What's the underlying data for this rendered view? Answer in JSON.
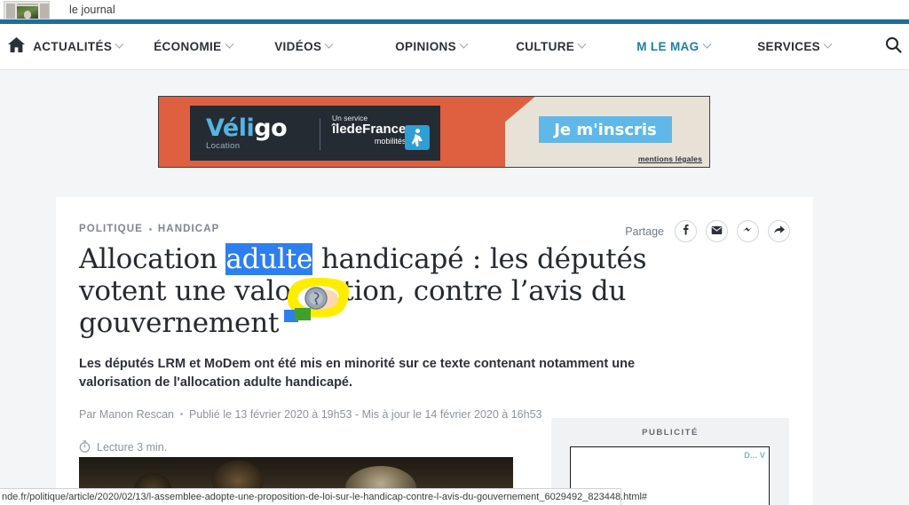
{
  "browser": {
    "tab_title": "le journal",
    "status_url": "nde.fr/politique/article/2020/02/13/l-assemblee-adopte-une-proposition-de-loi-sur-le-handicap-contre-l-avis-du-gouvernement_6029492_823448.html#"
  },
  "nav": {
    "home_icon": "home-icon",
    "search_icon": "search-icon",
    "items": [
      {
        "label": "ACTUALITÉS",
        "has_caret": true,
        "accent": false
      },
      {
        "label": "ÉCONOMIE",
        "has_caret": true,
        "accent": false
      },
      {
        "label": "VIDÉOS",
        "has_caret": true,
        "accent": false
      },
      {
        "label": "OPINIONS",
        "has_caret": true,
        "accent": false
      },
      {
        "label": "CULTURE",
        "has_caret": true,
        "accent": false
      },
      {
        "label": "M LE MAG",
        "has_caret": true,
        "accent": true
      },
      {
        "label": "SERVICES",
        "has_caret": true,
        "accent": false
      }
    ],
    "accent_color": "#1a7fa8",
    "top_rule_color": "#1a6f9e"
  },
  "ad_banner": {
    "brand": "Véligo",
    "brand_part_1": "Véli",
    "brand_part_2": "go",
    "brand_sub": "Location",
    "service_line": "Un service",
    "operator": "îledeFrance",
    "operator_light": "de",
    "operator_sub": "mobilités",
    "cta_label": "Je m'inscris",
    "legal_label": "mentions légales",
    "bg_color": "#df6040",
    "cta_color": "#5fb8e8"
  },
  "article": {
    "kicker_primary": "POLITIQUE",
    "kicker_secondary": "HANDICAP",
    "headline_part_1": "Allocation ",
    "headline_selected": "adulte",
    "headline_part_2": " handicapé : les députés votent une valorisation, contre l’avis du gouvernement",
    "selection_color": "#2d7fef",
    "standfirst": "Les députés LRM et MoDem ont été mis en minorité sur ce texte contenant notamment une valorisation de l'allocation adulte handicapé.",
    "author": "Par Manon Rescan",
    "published": "Publié le 13 février 2020 à 19h53 - Mis à jour le 14 février 2020 à 16h53",
    "read_time": "Lecture 3 min.",
    "read_time_icon": "stopwatch-icon"
  },
  "share": {
    "label": "Partage",
    "buttons": [
      {
        "name": "facebook-icon",
        "glyph": "f"
      },
      {
        "name": "email-icon",
        "glyph": "✉"
      },
      {
        "name": "messenger-icon",
        "glyph": "~"
      },
      {
        "name": "share-arrow-icon",
        "glyph": "➤"
      }
    ]
  },
  "rail": {
    "ad_label": "PUBLICITÉ",
    "ad_tag": "D... V"
  },
  "annotation": {
    "highlight_color": "#ffed00",
    "cursor_icon": "busy-cursor-icon"
  }
}
